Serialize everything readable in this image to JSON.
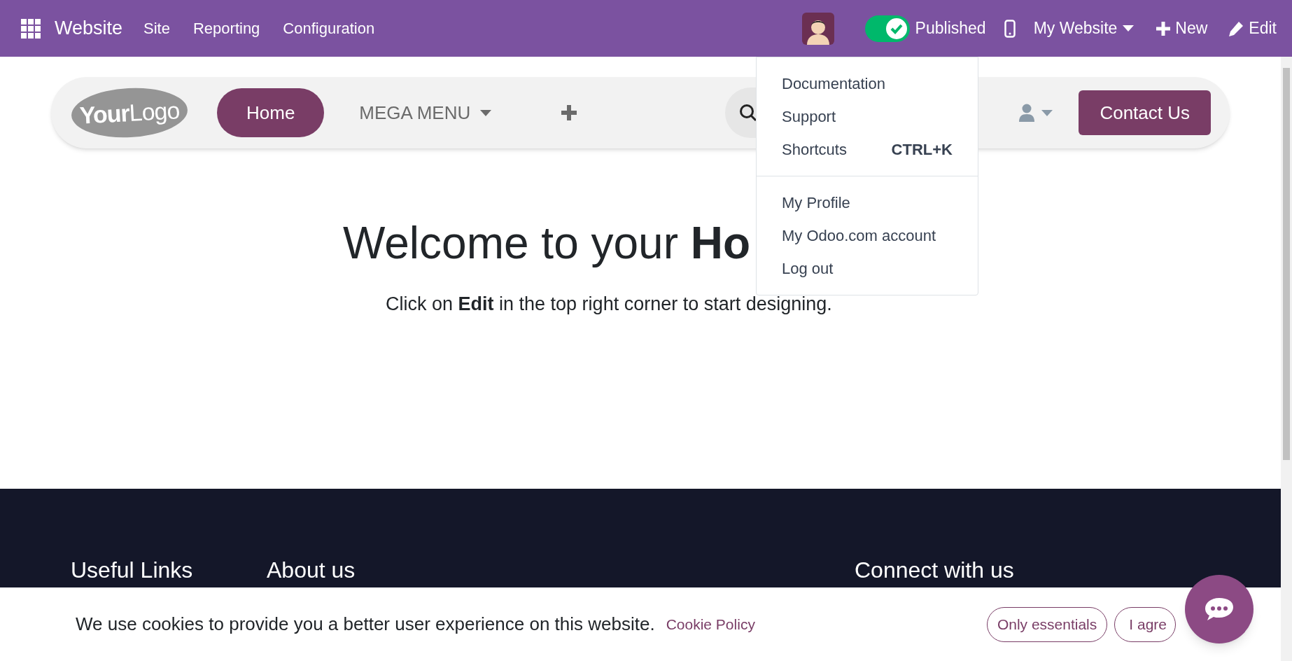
{
  "top_bar": {
    "app_name": "Website",
    "menu": [
      "Site",
      "Reporting",
      "Configuration"
    ],
    "published": {
      "label": "Published",
      "on": true
    },
    "website_switcher": "My Website",
    "new_button": "New",
    "edit_button": "Edit"
  },
  "user_menu": {
    "sections": [
      [
        {
          "label": "Documentation"
        },
        {
          "label": "Support"
        },
        {
          "label": "Shortcuts",
          "shortcut": "CTRL+K"
        }
      ],
      [
        {
          "label": "My Profile"
        },
        {
          "label": "My Odoo.com account"
        },
        {
          "label": "Log out"
        }
      ]
    ]
  },
  "site_header": {
    "logo": "**Your**Logo",
    "nav": [
      {
        "label": "Home",
        "selected": true,
        "dropdown": false
      },
      {
        "label": "MEGA MENU",
        "selected": false,
        "dropdown": true
      }
    ],
    "contact_button": "Contact Us"
  },
  "hero": {
    "title": "Welcome to your **Ho**",
    "subtitle": "Click on **Edit** in the top right corner to start designing."
  },
  "footer": {
    "headings": [
      "Useful Links",
      "About us",
      "Connect with us"
    ]
  },
  "cookie_bar": {
    "message": "We use cookies to provide you a better user experience on this website.",
    "policy_link": "Cookie Policy",
    "buttons": [
      "Only essentials",
      "I agre"
    ]
  }
}
